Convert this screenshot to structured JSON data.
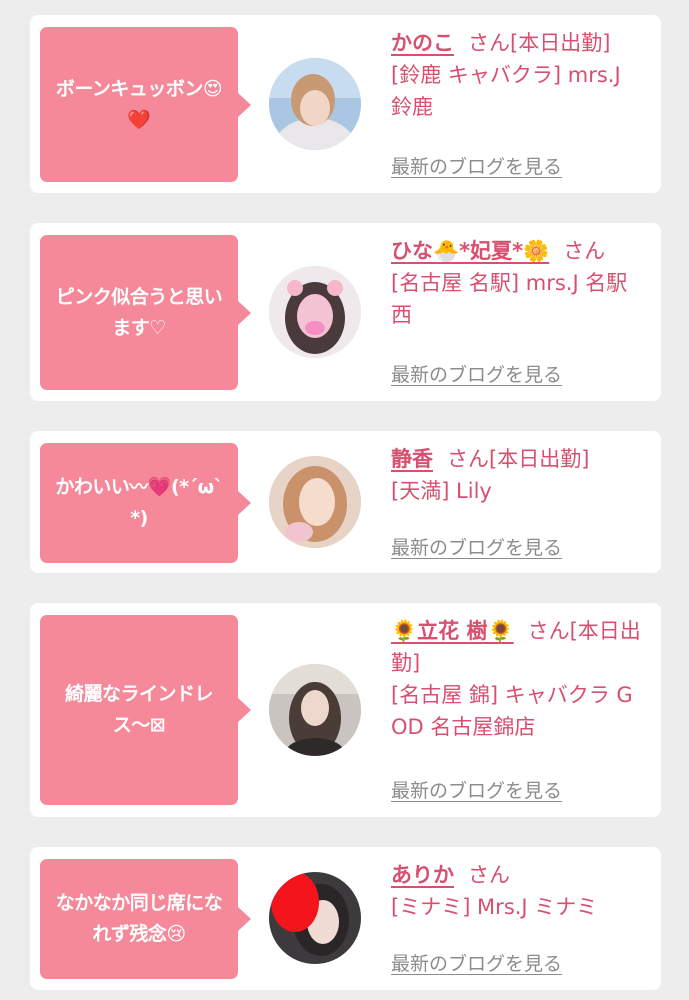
{
  "cards": [
    {
      "comment": "ボーンキュッボン😍❤️",
      "name": "かのこ",
      "san": "さん",
      "status": "[本日出勤]",
      "store": "[鈴鹿 キャバクラ] mrs.J 鈴鹿",
      "blog_link": "最新のブログを見る",
      "avatar_icon": "woman-photo-avatar"
    },
    {
      "comment": "ピンク似合うと思います♡",
      "name": "ひな🐣*妃夏*🌼",
      "san": "さん",
      "status": "",
      "store": "[名古屋 名駅] mrs.J 名駅西",
      "blog_link": "最新のブログを見る",
      "avatar_icon": "woman-photo-avatar"
    },
    {
      "comment": "かわいい〰💗(*´ω`*)",
      "name": "静香",
      "san": "さん",
      "status": "[本日出勤]",
      "store": "[天満] Lily",
      "blog_link": "最新のブログを見る",
      "avatar_icon": "woman-photo-avatar"
    },
    {
      "comment": "綺麗なラインドレス〜⊠",
      "name": "🌻立花 樹🌻",
      "san": "さん",
      "status": "[本日出勤]",
      "store": "[名古屋 錦] キャバクラ GOD 名古屋錦店",
      "blog_link": "最新のブログを見る",
      "avatar_icon": "woman-photo-avatar"
    },
    {
      "comment": "なかなか同じ席になれず残念😢",
      "name": "ありか",
      "san": "さん",
      "status": "",
      "store": "[ミナミ] Mrs.J ミナミ",
      "blog_link": "最新のブログを見る",
      "avatar_icon": "woman-photo-avatar"
    }
  ],
  "colors": {
    "bubble": "#f5899a",
    "name": "#d84f70",
    "link": "#8c8c8c",
    "background": "#ededed"
  }
}
